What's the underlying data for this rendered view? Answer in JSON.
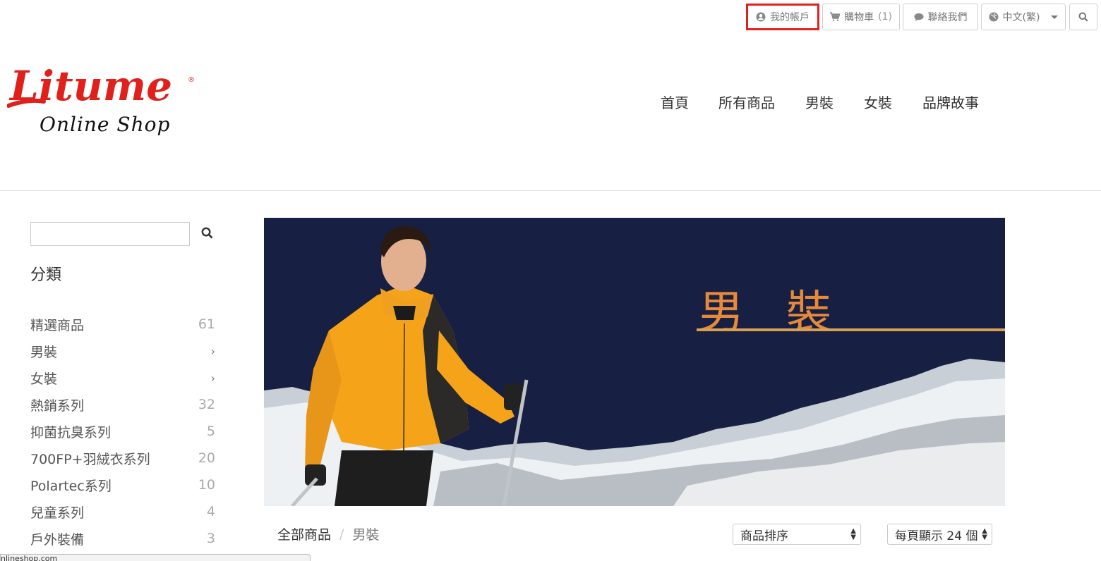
{
  "topbar": {
    "account_label": "我的帳戶",
    "cart_label": "購物車",
    "cart_count": "(1)",
    "contact_label": "聯絡我們",
    "language_label": "中文(繁)"
  },
  "logo": {
    "brand": "Litume",
    "tagline": "Online Shop",
    "brand_color": "#e0211b"
  },
  "mainnav": [
    "首頁",
    "所有商品",
    "男裝",
    "女裝",
    "品牌故事"
  ],
  "sidebar": {
    "search_placeholder": "",
    "title": "分類",
    "categories": [
      {
        "label": "精選商品",
        "count": "61"
      },
      {
        "label": "男裝",
        "count": "›"
      },
      {
        "label": "女裝",
        "count": "›"
      },
      {
        "label": "熱銷系列",
        "count": "32"
      },
      {
        "label": "抑菌抗臭系列",
        "count": "5"
      },
      {
        "label": "700FP+羽絨衣系列",
        "count": "20"
      },
      {
        "label": "Polartec系列",
        "count": "10"
      },
      {
        "label": "兒童系列",
        "count": "4"
      },
      {
        "label": "戶外裝備",
        "count": "3"
      }
    ]
  },
  "banner": {
    "title": "男裝",
    "background_color": "#172043",
    "accent_color": "#e68a3a"
  },
  "breadcrumb": {
    "home": "全部商品",
    "separator": "/",
    "current": "男裝"
  },
  "sort": {
    "selected": "商品排序",
    "per_page": "每頁顯示 24 個"
  },
  "status_bar": {
    "url": "nlineshop.com"
  }
}
